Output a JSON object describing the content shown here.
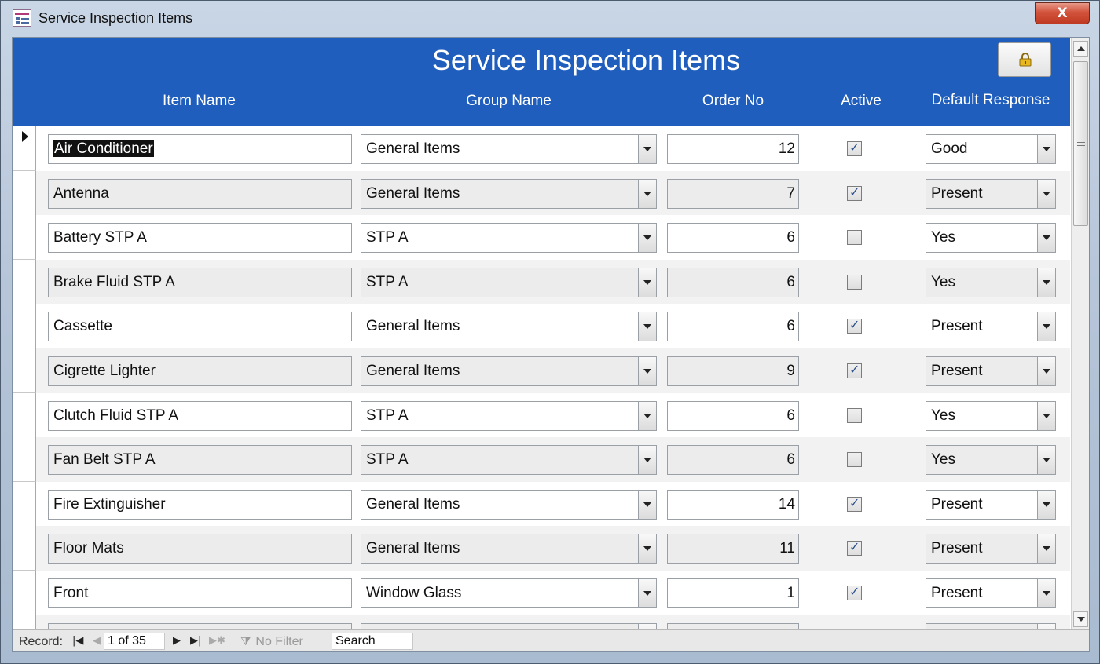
{
  "window": {
    "title": "Service Inspection Items",
    "close_label": "X"
  },
  "form": {
    "title": "Service Inspection Items",
    "columns": {
      "item_name": "Item Name",
      "group_name": "Group Name",
      "order_no": "Order No",
      "active": "Active",
      "default_response": "Default Response"
    }
  },
  "rows": [
    {
      "item_name": "Air Conditioner",
      "group_name": "General Items",
      "order_no": "12",
      "active": true,
      "default_response": "Good"
    },
    {
      "item_name": "Antenna",
      "group_name": "General Items",
      "order_no": "7",
      "active": true,
      "default_response": "Present"
    },
    {
      "item_name": "Battery STP A",
      "group_name": "STP A",
      "order_no": "6",
      "active": false,
      "default_response": "Yes"
    },
    {
      "item_name": "Brake Fluid STP A",
      "group_name": "STP A",
      "order_no": "6",
      "active": false,
      "default_response": "Yes"
    },
    {
      "item_name": "Cassette",
      "group_name": "General Items",
      "order_no": "6",
      "active": true,
      "default_response": "Present"
    },
    {
      "item_name": "Cigrette Lighter",
      "group_name": "General Items",
      "order_no": "9",
      "active": true,
      "default_response": "Present"
    },
    {
      "item_name": "Clutch Fluid STP A",
      "group_name": "STP A",
      "order_no": "6",
      "active": false,
      "default_response": "Yes"
    },
    {
      "item_name": "Fan Belt STP A",
      "group_name": "STP A",
      "order_no": "6",
      "active": false,
      "default_response": "Yes"
    },
    {
      "item_name": "Fire Extinguisher",
      "group_name": "General Items",
      "order_no": "14",
      "active": true,
      "default_response": "Present"
    },
    {
      "item_name": "Floor Mats",
      "group_name": "General Items",
      "order_no": "11",
      "active": true,
      "default_response": "Present"
    },
    {
      "item_name": "Front",
      "group_name": "Window Glass",
      "order_no": "1",
      "active": true,
      "default_response": "Present"
    }
  ],
  "navigation": {
    "record_label": "Record:",
    "record_position": "1 of 35",
    "filter_label": "No Filter",
    "search_text": "Search"
  },
  "icons": {
    "lock": "lock-icon",
    "first": "first-record-icon",
    "prev": "previous-record-icon",
    "next": "next-record-icon",
    "last": "last-record-icon",
    "new": "new-record-icon",
    "filter": "filter-icon"
  },
  "colors": {
    "header": "#1f5ebd",
    "alt_row": "#f2f2f2"
  }
}
